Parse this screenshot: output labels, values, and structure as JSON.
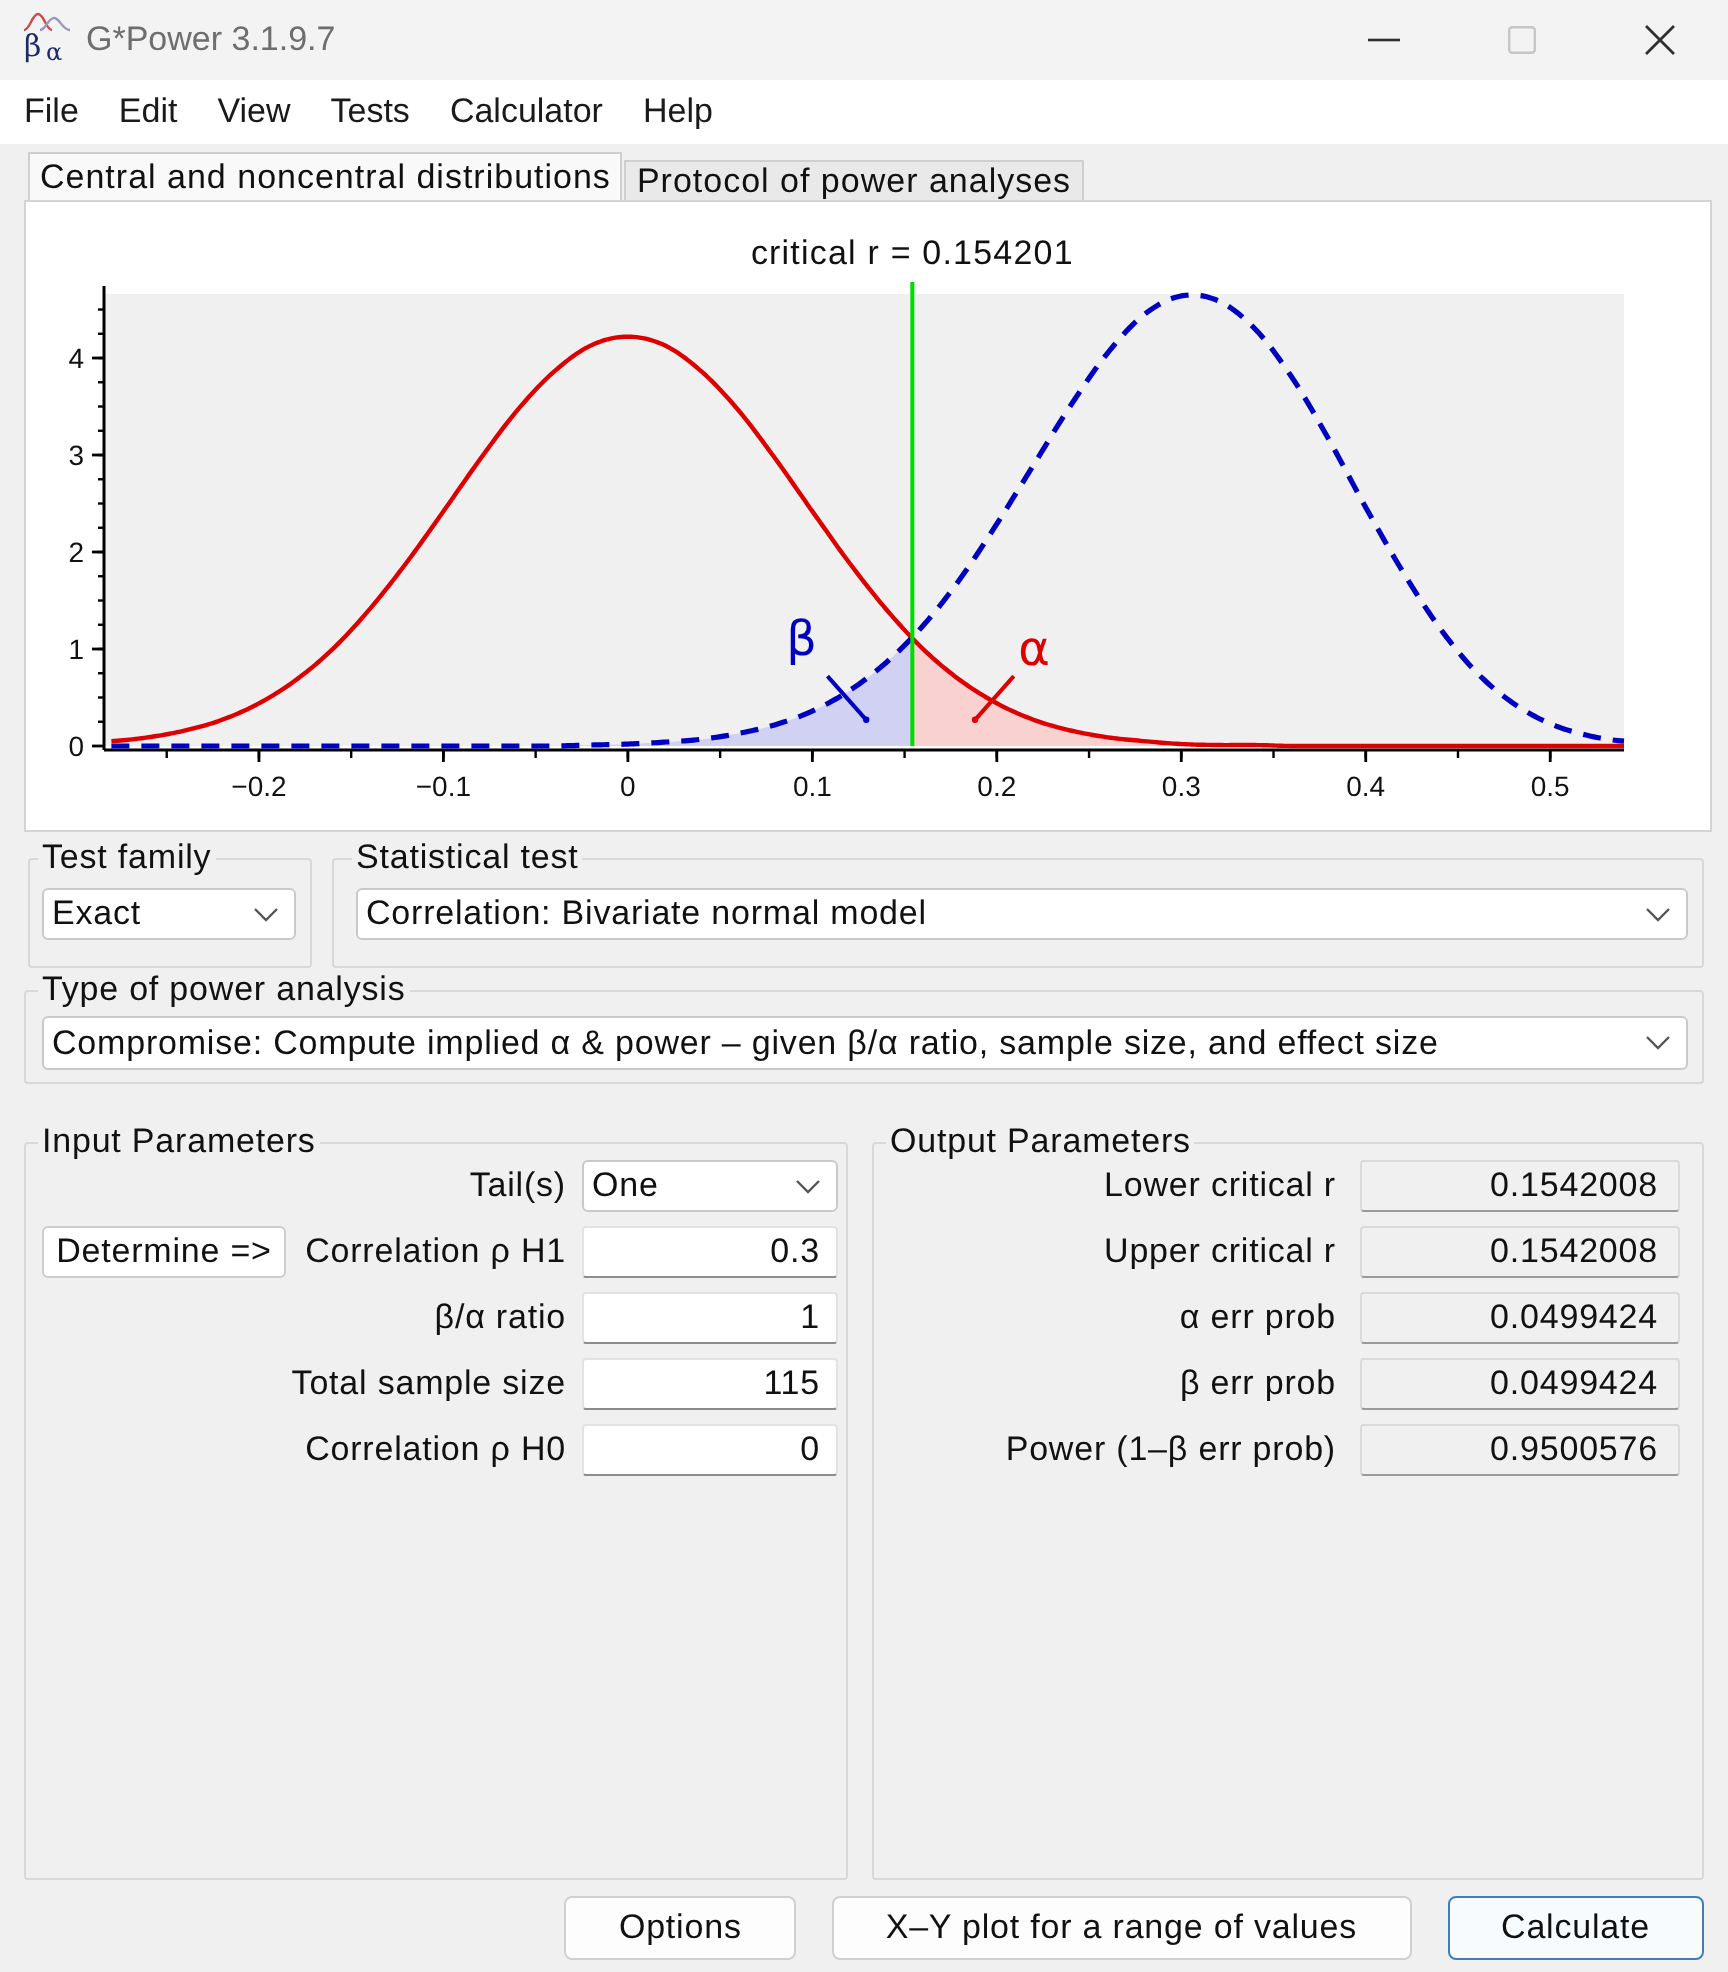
{
  "window": {
    "title": "G*Power 3.1.9.7",
    "logo": {
      "main": "β",
      "sub": "α"
    },
    "controls": [
      {
        "kind": "minimize",
        "disabled": false
      },
      {
        "kind": "maximize",
        "disabled": true
      },
      {
        "kind": "close",
        "disabled": false
      }
    ]
  },
  "menu": [
    "File",
    "Edit",
    "View",
    "Tests",
    "Calculator",
    "Help"
  ],
  "tabs": [
    {
      "label": "Central and noncentral distributions",
      "selected": true
    },
    {
      "label": "Protocol of power analyses",
      "selected": false
    }
  ],
  "distribution_plot": {
    "chart_data": {
      "type": "line",
      "title": "critical r = 0.154201",
      "x": [
        -0.28,
        -0.26,
        -0.24,
        -0.22,
        -0.2,
        -0.18,
        -0.16,
        -0.14,
        -0.12,
        -0.1,
        -0.08,
        -0.06,
        -0.04,
        -0.02,
        0,
        0.02,
        0.04,
        0.06,
        0.08,
        0.1,
        0.12,
        0.14,
        0.16,
        0.18,
        0.2,
        0.22,
        0.24,
        0.26,
        0.28,
        0.3,
        0.32,
        0.34,
        0.36,
        0.38,
        0.4,
        0.42,
        0.44,
        0.46,
        0.48,
        0.5,
        0.52,
        0.54
      ],
      "series": [
        {
          "color": "#dd0000",
          "line_style": "solid",
          "values": [
            0.05,
            0.09,
            0.16,
            0.27,
            0.44,
            0.68,
            1,
            1.41,
            1.89,
            2.42,
            2.96,
            3.46,
            3.86,
            4.13,
            4.22,
            4.13,
            3.86,
            3.46,
            2.96,
            2.42,
            1.89,
            1.41,
            1,
            0.68,
            0.44,
            0.27,
            0.16,
            0.09,
            0.05,
            0.02,
            0.01,
            0.01,
            0,
            0,
            0,
            0,
            0,
            0,
            0,
            0,
            0,
            0
          ]
        },
        {
          "color": "#0000c0",
          "line_style": "dashed",
          "values": [
            0,
            0,
            0,
            0,
            0,
            0,
            0,
            0,
            0,
            0,
            0,
            0,
            0,
            0.01,
            0.02,
            0.04,
            0.07,
            0.13,
            0.22,
            0.36,
            0.57,
            0.86,
            1.24,
            1.72,
            2.29,
            2.9,
            3.51,
            4.05,
            4.45,
            4.64,
            4.59,
            4.3,
            3.8,
            3.16,
            2.46,
            1.8,
            1.22,
            0.76,
            0.44,
            0.23,
            0.11,
            0.05
          ]
        }
      ],
      "xlim": [
        -0.284,
        0.54
      ],
      "ylim": [
        0,
        4.66
      ],
      "xticks": [
        {
          "value": -0.2,
          "label": "−0.2"
        },
        {
          "value": -0.1,
          "label": "−0.1"
        },
        0,
        0.1,
        0.2,
        0.3,
        0.4,
        0.5
      ],
      "yticks": [
        0,
        1,
        2,
        3,
        4
      ],
      "ref_lines": [
        {
          "axis": "x",
          "value": 0.1542,
          "color": "#00dd00"
        }
      ],
      "annotations": [
        "β",
        "α"
      ]
    }
  },
  "test_family": {
    "title": "Test family",
    "value": "Exact"
  },
  "statistical_test": {
    "title": "Statistical test",
    "value": "Correlation: Bivariate normal model"
  },
  "type_of_power_analysis": {
    "title": "Type of power analysis",
    "value": "Compromise: Compute implied α & power – given β/α ratio, sample size, and effect size"
  },
  "input_parameters": {
    "title": "Input Parameters",
    "rows": [
      {
        "kind": "select",
        "label": "Tail(s)",
        "value": "One"
      },
      {
        "kind": "number",
        "label": "Correlation ρ H1",
        "value": "0.3",
        "button": "Determine =>"
      },
      {
        "kind": "number",
        "label": "β/α ratio",
        "value": "1"
      },
      {
        "kind": "number",
        "label": "Total sample size",
        "value": "115"
      },
      {
        "kind": "number",
        "label": "Correlation ρ H0",
        "value": "0"
      }
    ]
  },
  "output_parameters": {
    "title": "Output Parameters",
    "rows": [
      {
        "label": "Lower critical r",
        "value": "0.1542008"
      },
      {
        "label": "Upper critical r",
        "value": "0.1542008"
      },
      {
        "label": "α err prob",
        "value": "0.0499424"
      },
      {
        "label": "β err prob",
        "value": "0.0499424"
      },
      {
        "label": "Power (1–β err prob)",
        "value": "0.9500576"
      }
    ]
  },
  "buttons": [
    {
      "label": "Options",
      "default": false
    },
    {
      "label": "X–Y plot for a range of values",
      "default": false
    },
    {
      "label": "Calculate",
      "default": true
    }
  ]
}
